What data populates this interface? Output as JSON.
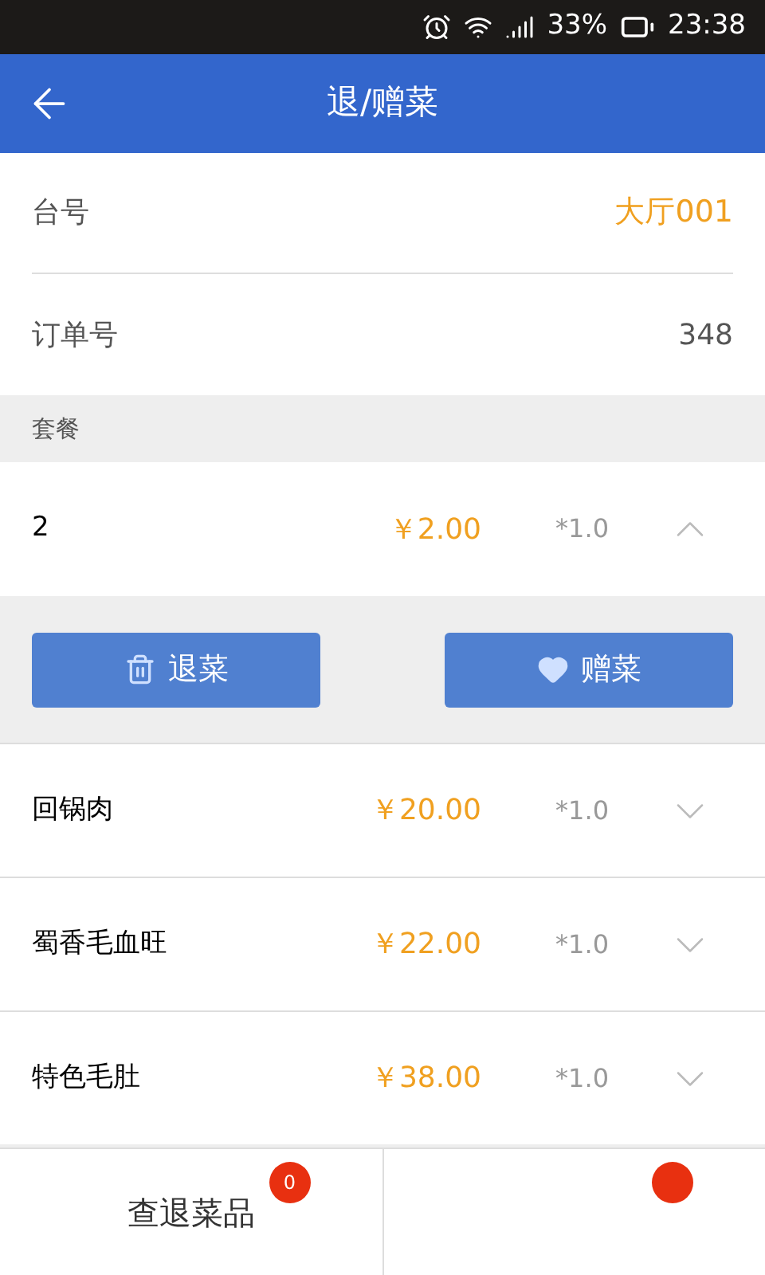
{
  "status_bar": {
    "battery": "33%",
    "time": "23:38"
  },
  "header": {
    "title": "退/赠菜"
  },
  "info_rows": [
    {
      "label": "台号",
      "value": "大厅001",
      "highlight": true
    },
    {
      "label": "订单号",
      "value": "348",
      "highlight": false
    }
  ],
  "section": {
    "title": "套餐"
  },
  "dishes": [
    {
      "name": "2",
      "price": "￥2.00",
      "qty": "*1.0",
      "expanded": true,
      "actions": [
        "退菜",
        "赠菜"
      ]
    },
    {
      "name": "回锅肉",
      "price": "￥20.00",
      "qty": "*1.0",
      "expanded": false
    },
    {
      "name": "蜀香毛血旺",
      "price": "￥22.00",
      "qty": "*1.0",
      "expanded": false
    },
    {
      "name": "特色毛肚",
      "price": "￥38.00",
      "qty": "*1.0",
      "expanded": false
    }
  ],
  "bottom_tabs": [
    {
      "label": "查退菜品",
      "badge": "0"
    },
    {
      "badge_shown": true
    }
  ]
}
